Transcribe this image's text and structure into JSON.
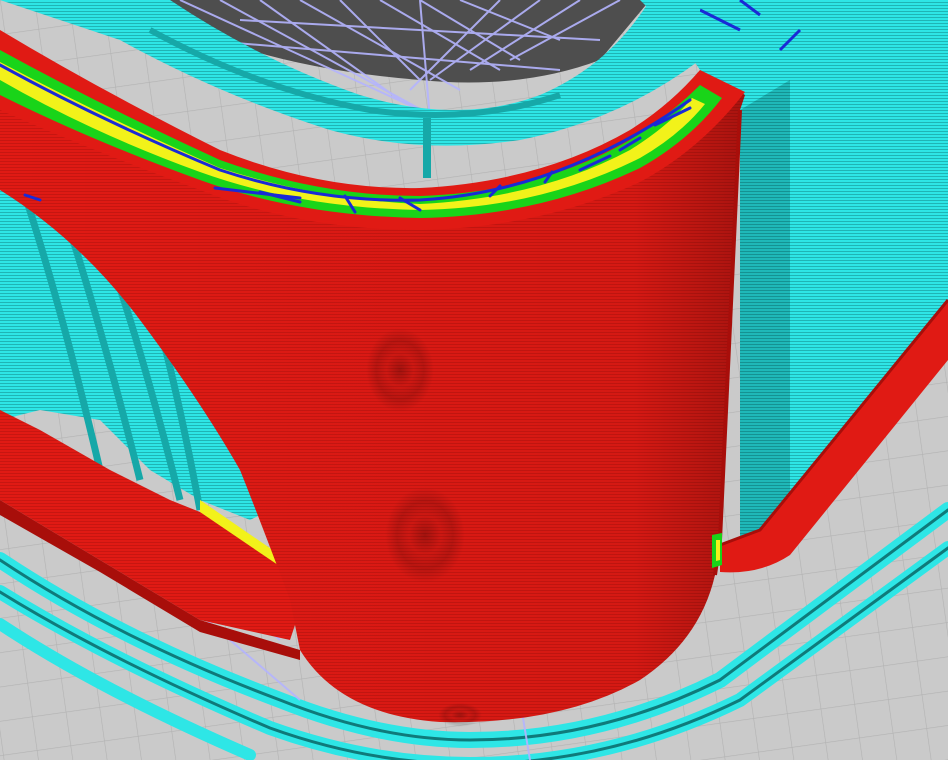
{
  "viewer": {
    "view": "layer-preview",
    "colors": {
      "outer_wall": "#e01a14",
      "outer_wall_dark": "#a80e0a",
      "inner_wall": "#2ee6e6",
      "inner_wall_dark": "#16a8a8",
      "infill": "#f2f21a",
      "skin": "#19d419",
      "travel": "#1a2ad6",
      "support": "#b4b4ff",
      "build_plate": "#cacaca",
      "grid_line": "#b2b2b2",
      "background_dark": "#4e4e4e"
    },
    "line_types": [
      "outer-wall",
      "inner-wall",
      "infill",
      "skin",
      "travel",
      "support"
    ]
  }
}
